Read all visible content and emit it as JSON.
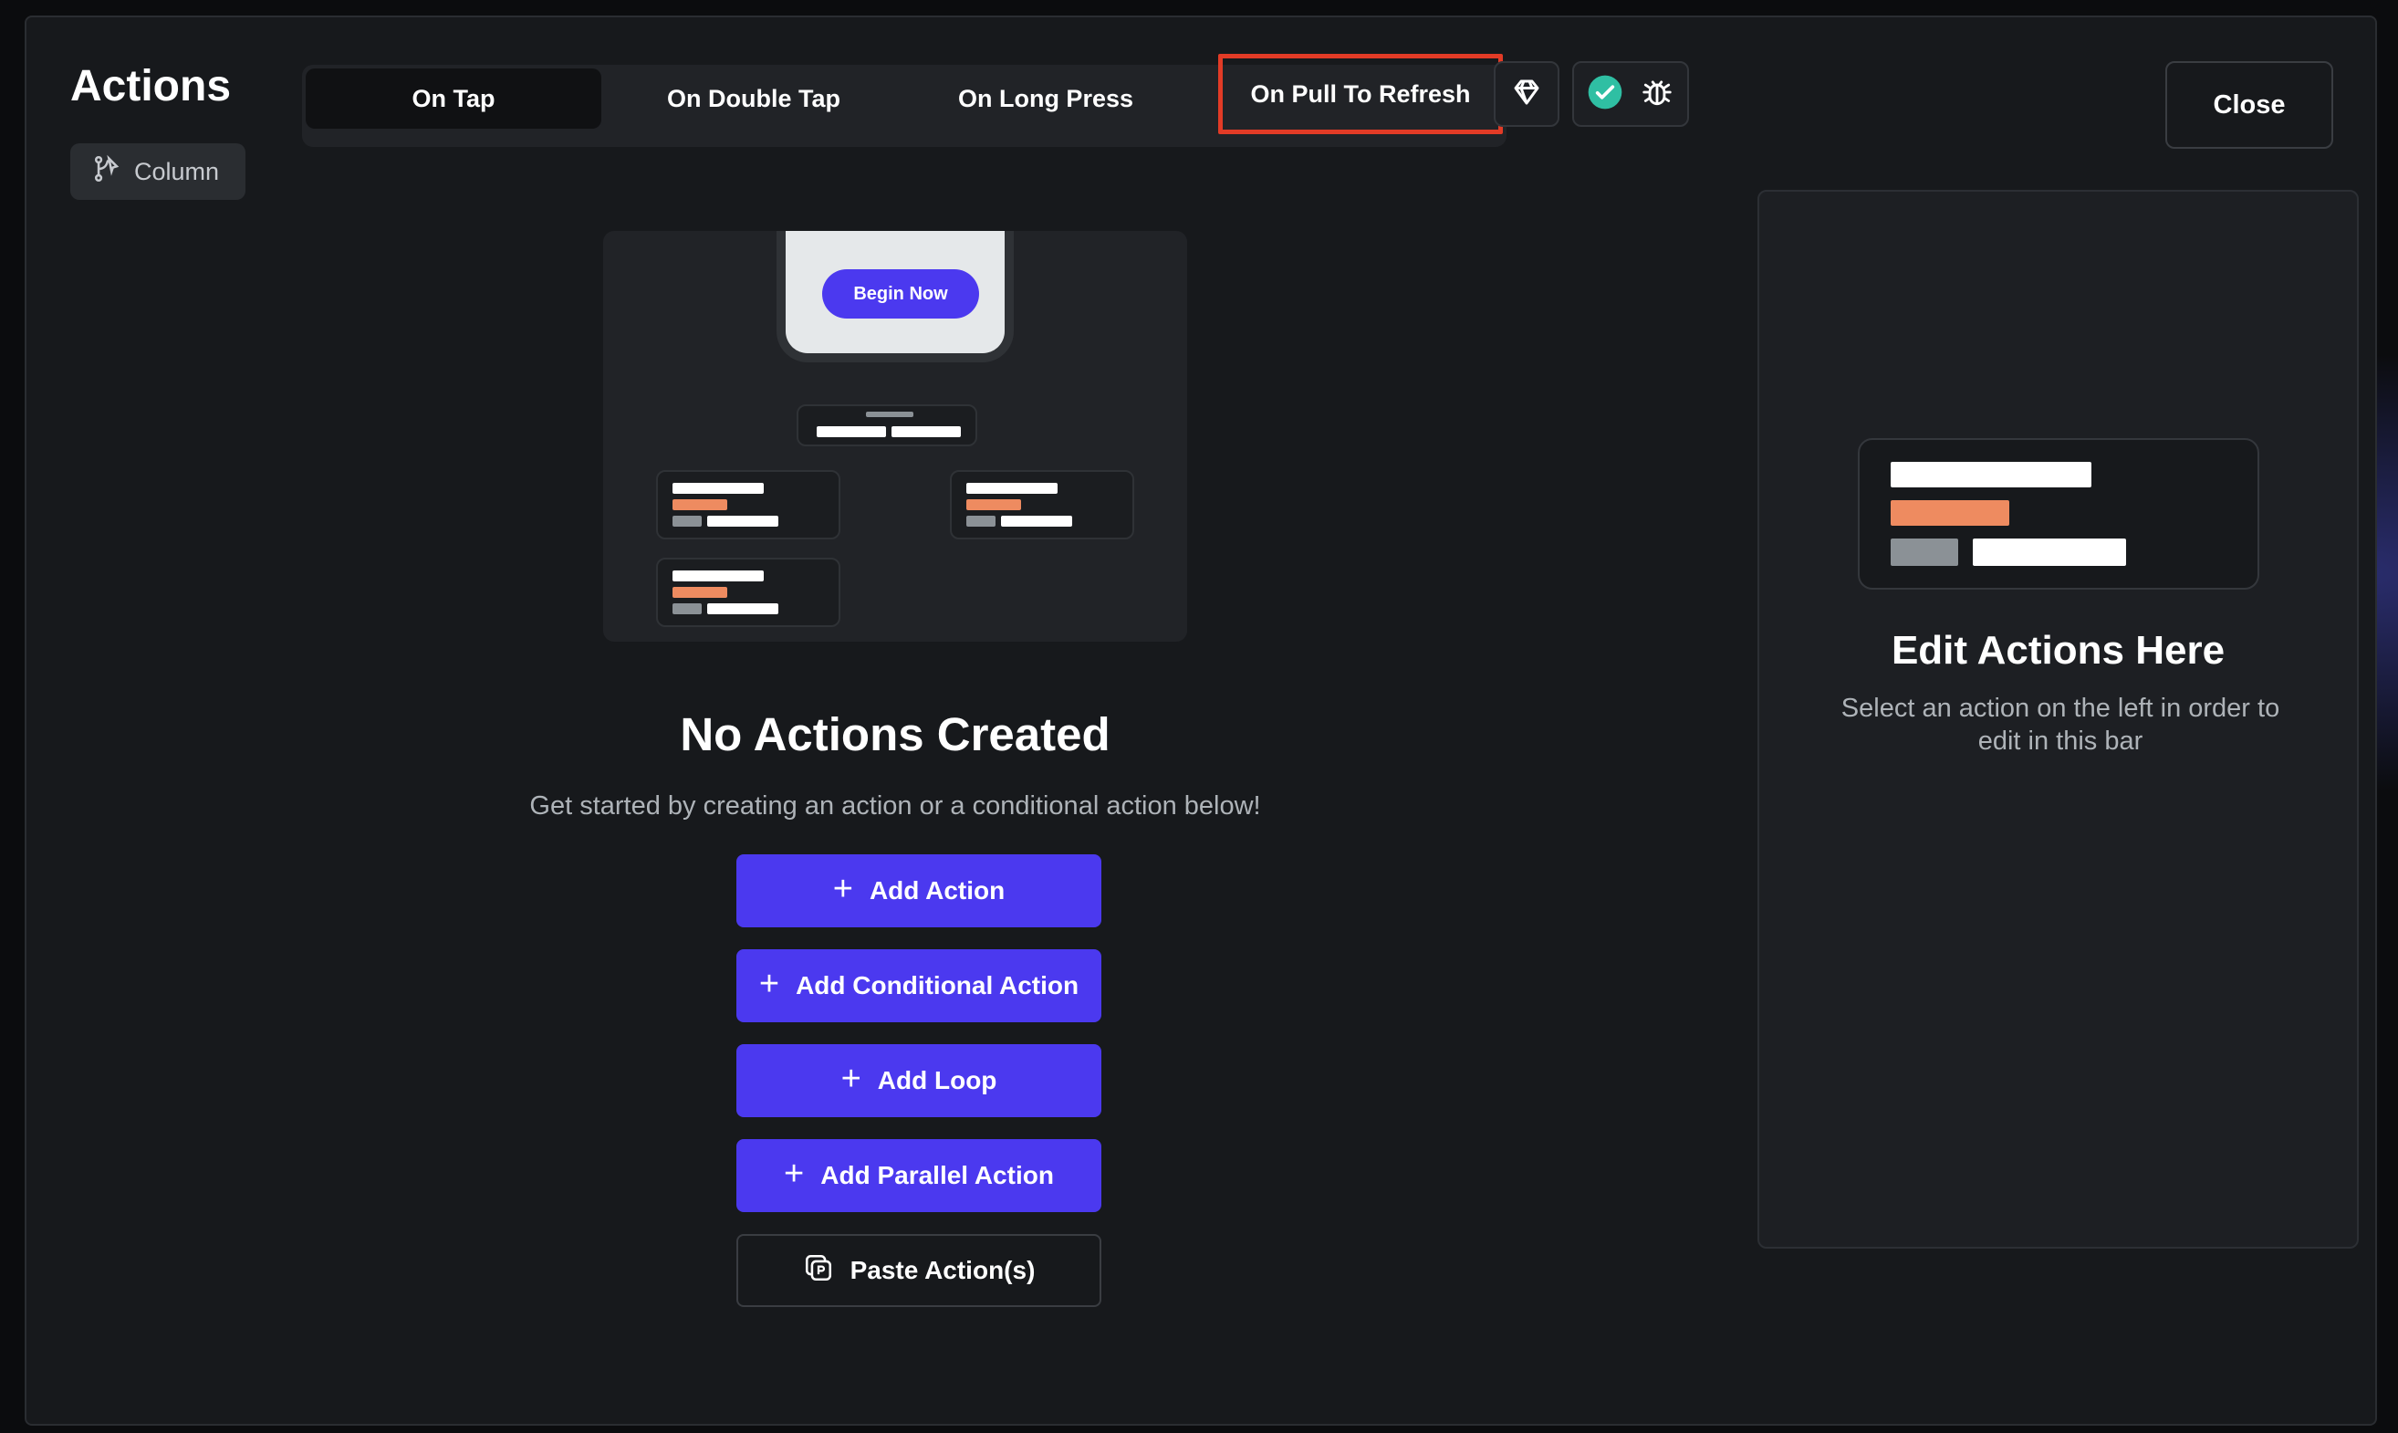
{
  "header": {
    "title": "Actions",
    "widget_label": "Column"
  },
  "tabs": [
    {
      "label": "On Tap",
      "active": true
    },
    {
      "label": "On Double Tap",
      "active": false
    },
    {
      "label": "On Long Press",
      "active": false
    },
    {
      "label": "On Pull To Refresh",
      "active": false,
      "highlighted": true
    }
  ],
  "toolbar": {
    "close_label": "Close",
    "status_color": "#2fbfa3",
    "highlight_color": "#e23b26"
  },
  "illustration": {
    "button_label": "Begin Now"
  },
  "empty_state": {
    "title": "No Actions Created",
    "subtitle": "Get started by creating an action or a conditional action below!"
  },
  "buttons": {
    "add_action": "Add Action",
    "add_conditional": "Add Conditional Action",
    "add_loop": "Add Loop",
    "add_parallel": "Add Parallel Action",
    "paste": "Paste Action(s)"
  },
  "side_panel": {
    "title": "Edit Actions Here",
    "subtitle": "Select an action on the left in order to edit in this bar"
  },
  "colors": {
    "accent": "#4b39ef",
    "orange": "#ee8b60"
  }
}
